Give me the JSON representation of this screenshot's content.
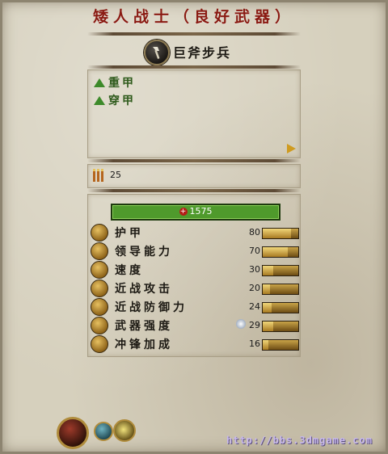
{
  "title": "矮人战士（良好武器）",
  "unit": {
    "name": "巨斧步兵",
    "icon": "axe-icon"
  },
  "traits": [
    {
      "label": "重甲",
      "icon": "green-up-triangle-icon"
    },
    {
      "label": "穿甲",
      "icon": "green-up-triangle-icon"
    }
  ],
  "ammo": {
    "icon": "ammo-icon",
    "value": "25"
  },
  "health": {
    "value": "1575",
    "icon": "health-cross-icon",
    "fill_fraction": 1.0
  },
  "stats": [
    {
      "label": "护甲",
      "value": "80",
      "icon": "armor-icon",
      "fill_fraction": 0.8
    },
    {
      "label": "领导能力",
      "value": "70",
      "icon": "leadership-icon",
      "fill_fraction": 0.7
    },
    {
      "label": "速度",
      "value": "30",
      "icon": "speed-icon",
      "fill_fraction": 0.3
    },
    {
      "label": "近战攻击",
      "value": "20",
      "icon": "melee-attack-icon",
      "fill_fraction": 0.2
    },
    {
      "label": "近战防御力",
      "value": "24",
      "icon": "melee-defence-icon",
      "fill_fraction": 0.24
    },
    {
      "label": "武器强度",
      "value": "29",
      "icon": "weapon-strength-icon",
      "fill_fraction": 0.29
    },
    {
      "label": "冲锋加成",
      "value": "16",
      "icon": "charge-bonus-icon",
      "fill_fraction": 0.16
    }
  ],
  "bottom_buttons": [
    "portrait-button",
    "shield-button",
    "eye-button"
  ],
  "watermark": "http://bbs.3dmgame.com",
  "colors": {
    "title": "#8a1a12",
    "trait": "#2f5b1c",
    "health_bar": "#4f9a2c",
    "stat_bar": "#c9a448"
  }
}
